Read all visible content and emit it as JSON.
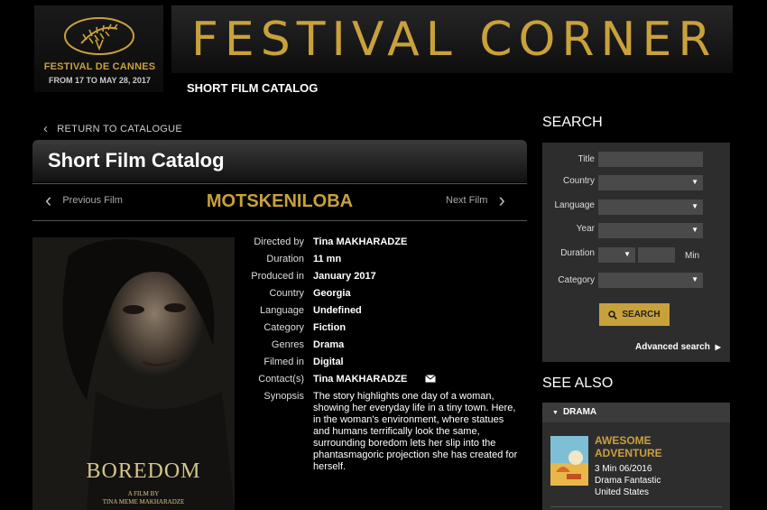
{
  "header": {
    "logo_name": "FESTIVAL DE CANNES",
    "logo_dates": "FROM 17 TO MAY 28, 2017",
    "banner": "FESTIVAL CORNER",
    "section": "SHORT FILM CATALOG"
  },
  "nav": {
    "return": "RETURN TO CATALOGUE",
    "catalog_title": "Short Film Catalog",
    "prev": "Previous Film",
    "next": "Next Film",
    "film_title": "MOTSKENILOBA"
  },
  "poster": {
    "title": "BOREDOM",
    "credit_1": "A FILM BY",
    "credit_2": "TINA MEME MAKHARADZE"
  },
  "details": [
    {
      "label": "Directed by",
      "value": "Tina MAKHARADZE"
    },
    {
      "label": "Duration",
      "value": "11 mn"
    },
    {
      "label": "Produced in",
      "value": "January 2017"
    },
    {
      "label": "Country",
      "value": "Georgia"
    },
    {
      "label": "Language",
      "value": "Undefined"
    },
    {
      "label": "Category",
      "value": "Fiction"
    },
    {
      "label": "Genres",
      "value": "Drama"
    },
    {
      "label": "Filmed in",
      "value": "Digital"
    },
    {
      "label": "Contact(s)",
      "value": "Tina MAKHARADZE"
    },
    {
      "label": "Synopsis",
      "value": "The story highlights one day of a woman, showing her everyday life in a tiny town. Here, in the woman's environment, where statues and humans terrifically look the same, surrounding boredom lets her slip into the phantasmagoric projection she has created for herself."
    }
  ],
  "search": {
    "heading": "SEARCH",
    "title_label": "Title",
    "country_label": "Country",
    "language_label": "Language",
    "year_label": "Year",
    "duration_label": "Duration",
    "duration_unit": "Min",
    "category_label": "Category",
    "button": "SEARCH",
    "advanced": "Advanced search"
  },
  "see_also": {
    "heading": "SEE ALSO",
    "genre": "DRAMA",
    "item_title_1": "AWESOME",
    "item_title_2": "ADVENTURE",
    "item_meta_1": "3 Min 06/2016",
    "item_meta_2": "Drama Fantastic",
    "item_meta_3": "United States"
  },
  "colors": {
    "accent": "#c9a13c",
    "panel": "#2d2d2d",
    "input": "#4a4a4a"
  }
}
